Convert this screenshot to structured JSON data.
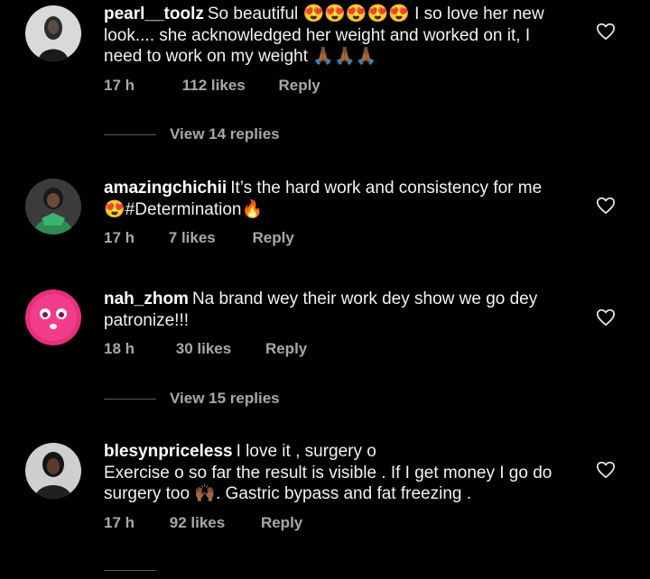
{
  "comments": [
    {
      "username": "pearl__toolz",
      "lines": [
        "So beautiful 😍😍😍😍😍 I so love her new",
        "look.... she acknowledged her weight and worked on it, I",
        "need to work on my weight 🙏🏾🙏🏾🙏🏾"
      ],
      "time": "17 h",
      "likes": "112 likes",
      "reply": "Reply",
      "view_replies": "View 14 replies"
    },
    {
      "username": "amazingchichii",
      "lines": [
        "It’s the hard work and consistency for me",
        "😍#Determination🔥"
      ],
      "time": "17 h",
      "likes": "7 likes",
      "reply": "Reply"
    },
    {
      "username": "nah_zhom",
      "lines": [
        "Na brand wey their work dey show we go dey",
        "patronize!!!"
      ],
      "time": "18 h",
      "likes": "30 likes",
      "reply": "Reply",
      "view_replies": "View 15 replies"
    },
    {
      "username": "blesynpriceless",
      "lines": [
        "I love it , surgery o",
        "Exercise o so far the result is visible . If I get money I go do",
        "surgery too 🙌🏾. Gastric bypass and fat freezing ."
      ],
      "time": "17 h",
      "likes": "92 likes",
      "reply": "Reply"
    }
  ],
  "icons": {
    "heart": "heart-outline-icon"
  },
  "colors": {
    "background": "#000000",
    "text": "#f2f2f2",
    "meta": "#a8a8a8"
  }
}
